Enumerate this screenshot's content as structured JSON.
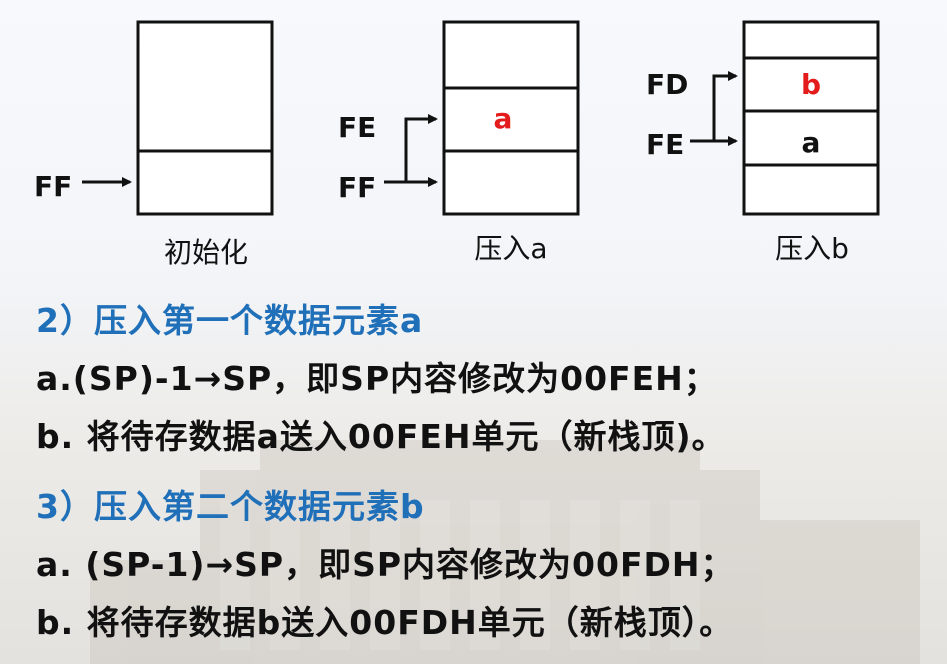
{
  "colors": {
    "heading": "#1f6fb9",
    "element_label": "#e31b1b",
    "text": "#111111"
  },
  "diagram": {
    "stage1": {
      "caption": "初始化",
      "pointer_ff": "FF",
      "arrow_icon": "right-arrow-icon"
    },
    "stage2": {
      "caption": "压入a",
      "pointer_fe": "FE",
      "pointer_ff": "FF",
      "cell_value": "a"
    },
    "stage3": {
      "caption": "压入b",
      "pointer_fd": "FD",
      "pointer_fe": "FE",
      "cell_value_b": "b",
      "cell_value_a": "a"
    }
  },
  "text": {
    "step2_heading": "2）压入第一个数据元素a",
    "step2_a": "a.(SP)-1→SP，即SP内容修改为00FEH；",
    "step2_b": "b. 将待存数据a送入00FEH单元（新栈顶)。",
    "step3_heading": "3）压入第二个数据元素b",
    "step3_a": "a. (SP-1)→SP，即SP内容修改为00FDH；",
    "step3_b": "b. 将待存数据b送入00FDH单元（新栈顶）。"
  }
}
